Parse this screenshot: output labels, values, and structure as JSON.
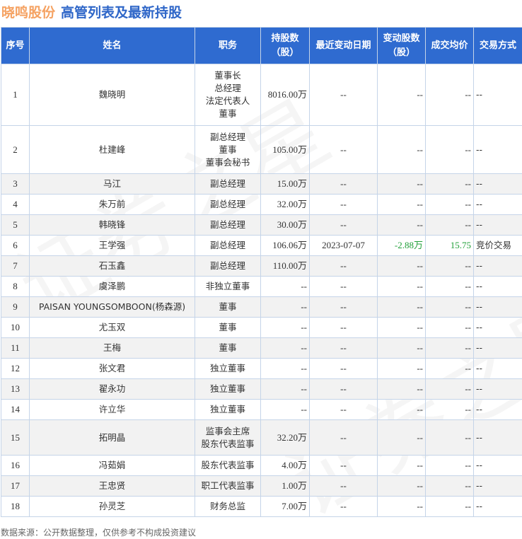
{
  "title": {
    "company": "晓鸣股份",
    "subtitle": "高管列表及最新持股"
  },
  "headers": [
    "序号",
    "姓名",
    "职务",
    "持股数（股）",
    "最近变动日期",
    "变动股数（股）",
    "成交均价",
    "交易方式"
  ],
  "rows": [
    [
      "1",
      "魏晓明",
      "董事长\n总经理\n法定代表人\n董事",
      "8016.00万",
      "--",
      "--",
      "--",
      "--"
    ],
    [
      "2",
      "杜建峰",
      "副总经理\n董事\n董事会秘书",
      "105.00万",
      "--",
      "--",
      "--",
      "--"
    ],
    [
      "3",
      "马江",
      "副总经理",
      "15.00万",
      "--",
      "--",
      "--",
      "--"
    ],
    [
      "4",
      "朱万前",
      "副总经理",
      "32.00万",
      "--",
      "--",
      "--",
      "--"
    ],
    [
      "5",
      "韩晓锋",
      "副总经理",
      "30.00万",
      "--",
      "--",
      "--",
      "--"
    ],
    [
      "6",
      "王学强",
      "副总经理",
      "106.06万",
      "2023-07-07",
      "-2.88万",
      "15.75",
      "竞价交易"
    ],
    [
      "7",
      "石玉鑫",
      "副总经理",
      "110.00万",
      "--",
      "--",
      "--",
      "--"
    ],
    [
      "8",
      "虞泽鹏",
      "非独立董事",
      "--",
      "--",
      "--",
      "--",
      "--"
    ],
    [
      "9",
      "PAISAN YOUNGSOMBOON(杨森源)",
      "董事",
      "--",
      "--",
      "--",
      "--",
      "--"
    ],
    [
      "10",
      "尤玉双",
      "董事",
      "--",
      "--",
      "--",
      "--",
      "--"
    ],
    [
      "11",
      "王梅",
      "董事",
      "--",
      "--",
      "--",
      "--",
      "--"
    ],
    [
      "12",
      "张文君",
      "独立董事",
      "--",
      "--",
      "--",
      "--",
      "--"
    ],
    [
      "13",
      "翟永功",
      "独立董事",
      "--",
      "--",
      "--",
      "--",
      "--"
    ],
    [
      "14",
      "许立华",
      "独立董事",
      "--",
      "--",
      "--",
      "--",
      "--"
    ],
    [
      "15",
      "拓明晶",
      "监事会主席\n股东代表监事",
      "32.20万",
      "--",
      "--",
      "--",
      "--"
    ],
    [
      "16",
      "冯茹娟",
      "股东代表监事",
      "4.00万",
      "--",
      "--",
      "--",
      "--"
    ],
    [
      "17",
      "王忠贤",
      "职工代表监事",
      "1.00万",
      "--",
      "--",
      "--",
      "--"
    ],
    [
      "18",
      "孙灵芝",
      "财务总监",
      "7.00万",
      "--",
      "--",
      "--",
      "--"
    ]
  ],
  "footer": "数据来源：公开数据整理，仅供参考不构成投资建议",
  "watermark": "证券之星",
  "colors": {
    "header_bg": "#2f6bd0",
    "company": "#f5a262",
    "subtitle": "#2e66c8",
    "positive_change": "#22a03a"
  }
}
